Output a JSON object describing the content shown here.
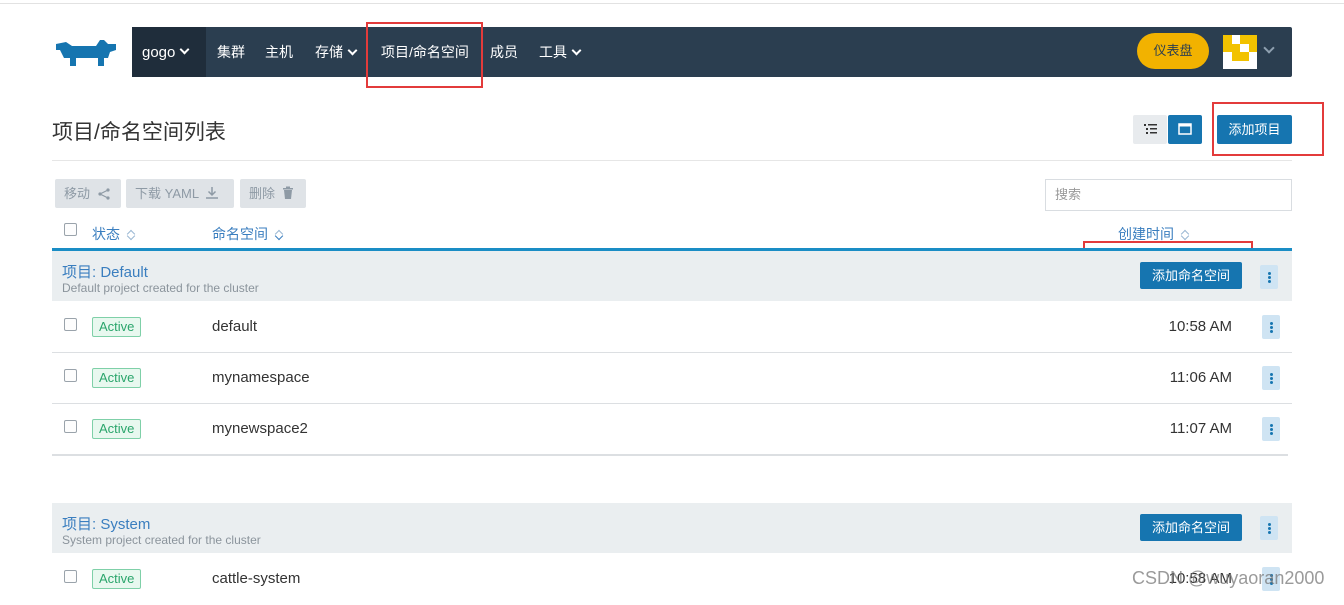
{
  "nav": {
    "cluster": "gogo",
    "items": [
      "集群",
      "主机",
      "存储",
      "项目/命名空间",
      "成员",
      "工具"
    ],
    "dashboard": "仪表盘"
  },
  "page": {
    "title": "项目/命名空间列表",
    "add_project": "添加项目"
  },
  "toolbar": {
    "move": "移动",
    "download": "下载 YAML",
    "delete": "删除",
    "search_placeholder": "搜索"
  },
  "table": {
    "col_state": "状态",
    "col_namespace": "命名空间",
    "col_created": "创建时间"
  },
  "groups": [
    {
      "title": "项目: Default",
      "desc": "Default project created for the cluster",
      "add_ns": "添加命名空间",
      "rows": [
        {
          "state": "Active",
          "name": "default",
          "time": "10:58 AM"
        },
        {
          "state": "Active",
          "name": "mynamespace",
          "time": "11:06 AM"
        },
        {
          "state": "Active",
          "name": "mynewspace2",
          "time": "11:07 AM"
        }
      ]
    },
    {
      "title": "项目: System",
      "desc": "System project created for the cluster",
      "add_ns": "添加命名空间",
      "rows": [
        {
          "state": "Active",
          "name": "cattle-system",
          "time": "10:58 AM"
        }
      ]
    }
  ],
  "watermark": "CSDN @wuyaoran2000",
  "colors": {
    "nav_bg": "#2b3e50",
    "accent": "#1675b0",
    "dashboard": "#f2b200",
    "active": "#2aa56b",
    "highlight": "#e33b3b"
  }
}
